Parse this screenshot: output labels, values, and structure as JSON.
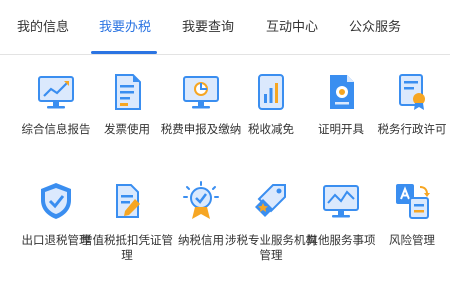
{
  "tabs": [
    {
      "label": "我的信息",
      "active": false
    },
    {
      "label": "我要办税",
      "active": true
    },
    {
      "label": "我要查询",
      "active": false
    },
    {
      "label": "互动中心",
      "active": false
    },
    {
      "label": "公众服务",
      "active": false
    }
  ],
  "services": [
    {
      "label": "综合信息报告",
      "icon": "monitor-chart-icon"
    },
    {
      "label": "发票使用",
      "icon": "invoice-document-icon"
    },
    {
      "label": "税费申报及缴纳",
      "icon": "monitor-report-icon"
    },
    {
      "label": "税收减免",
      "icon": "tablet-chart-icon"
    },
    {
      "label": "证明开具",
      "icon": "certificate-document-icon"
    },
    {
      "label": "税务行政许可",
      "icon": "license-ribbon-icon"
    },
    {
      "label": "出口退税管理",
      "icon": "shield-check-icon"
    },
    {
      "label": "增值税抵扣凭证管理",
      "icon": "document-edit-icon"
    },
    {
      "label": "纳税信用",
      "icon": "credit-badge-icon"
    },
    {
      "label": "涉税专业服务机构管理",
      "icon": "agency-tag-icon"
    },
    {
      "label": "其他服务事项",
      "icon": "monitor-trend-icon"
    },
    {
      "label": "风险管理",
      "icon": "translate-cards-icon"
    }
  ],
  "colors": {
    "accent": "#2b74e2",
    "icon_blue": "#3a8ef0",
    "icon_light": "#dbe9fd",
    "icon_orange": "#f6a623"
  }
}
